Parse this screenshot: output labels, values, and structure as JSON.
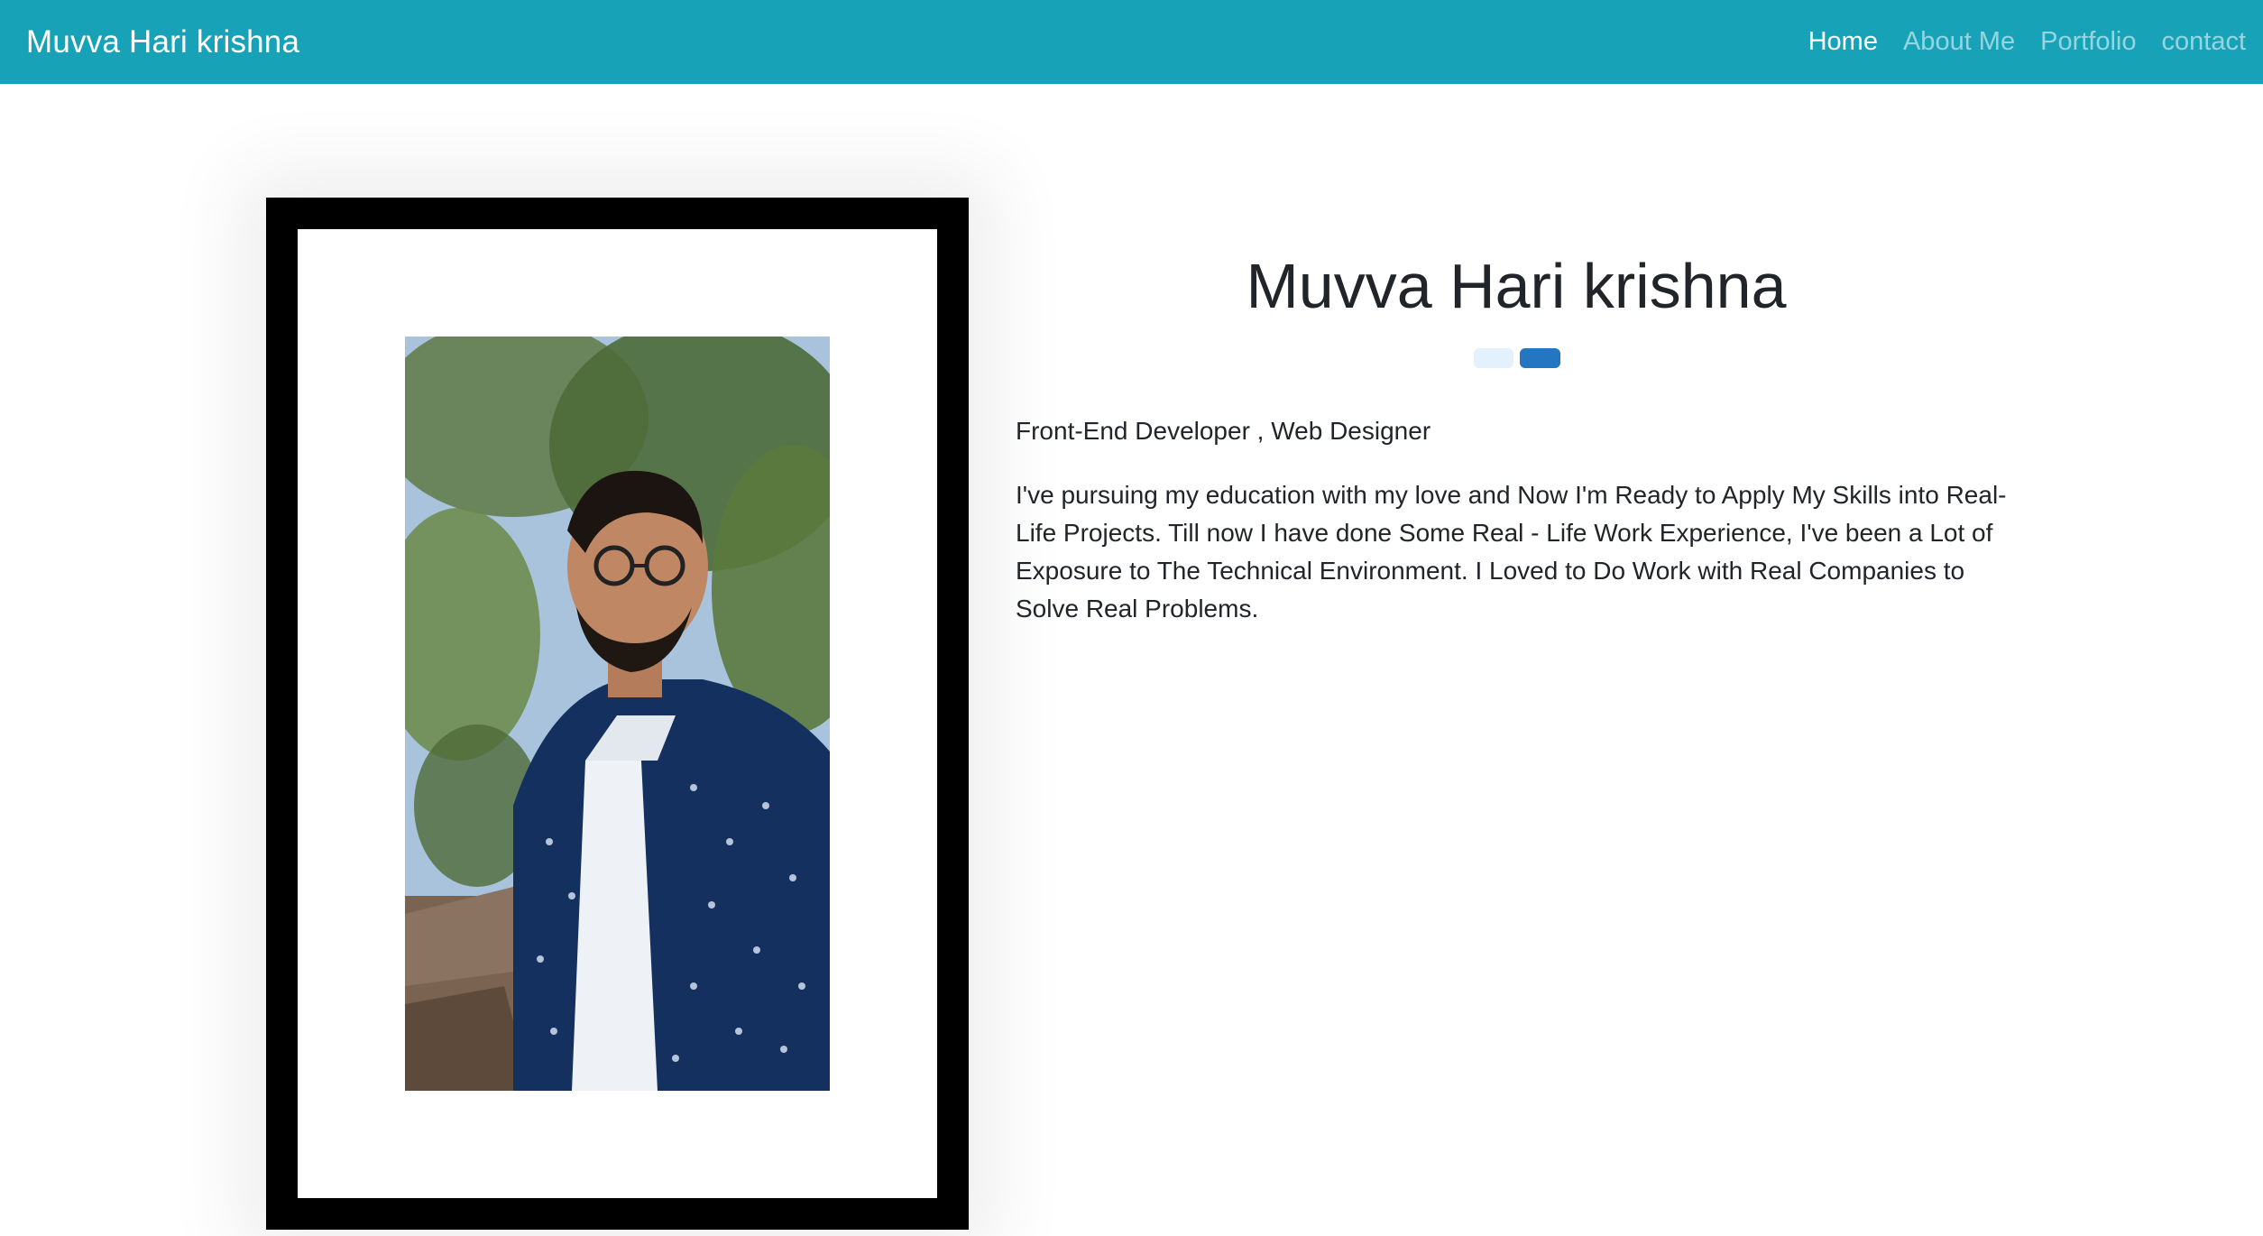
{
  "navbar": {
    "brand": "Muvva Hari krishna",
    "links": [
      {
        "label": "Home",
        "active": true
      },
      {
        "label": "About Me",
        "active": false
      },
      {
        "label": "Portfolio",
        "active": false
      },
      {
        "label": "contact",
        "active": false
      }
    ]
  },
  "profile": {
    "name": "Muvva Hari krishna",
    "role": "Front-End Developer , Web Designer",
    "bio": "I've pursuing my education with my love and Now I'm Ready to Apply My Skills into Real-Life Projects. Till now I have done Some Real - Life Work Experience, I've been a Lot of Exposure to The Technical Environment. I Loved to Do Work with Real Companies to Solve Real Problems."
  },
  "colors": {
    "navbar_bg": "#17a2b8",
    "accent_dark": "#2277c0",
    "accent_light": "#e3f1fc",
    "frame": "#000000"
  }
}
